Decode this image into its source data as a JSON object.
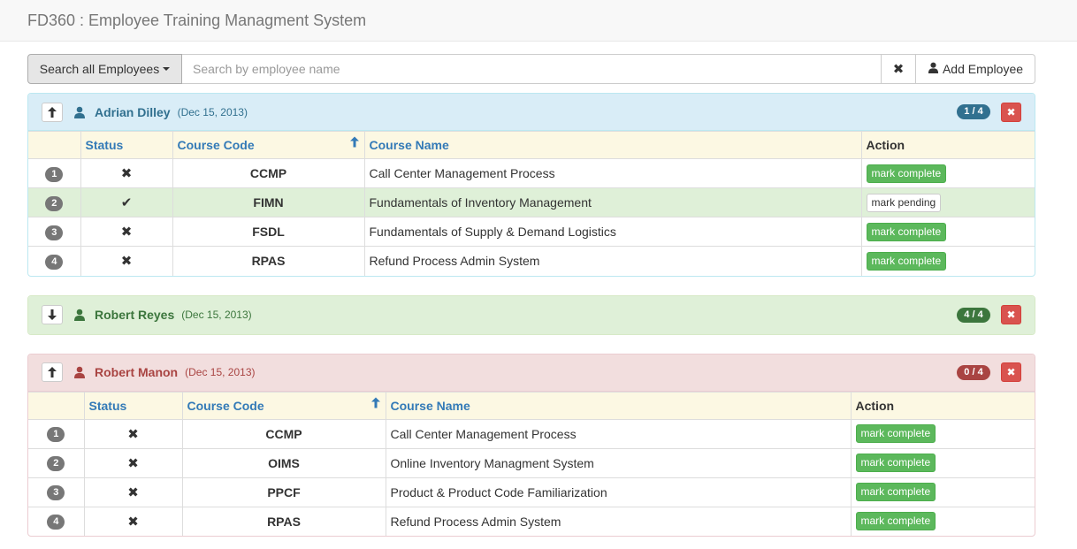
{
  "app": {
    "title": "FD360 : Employee Training Managment System"
  },
  "search": {
    "dropdown_label": "Search all Employees",
    "placeholder": "Search by employee name",
    "value": "",
    "clear_icon": "✖",
    "add_label": "Add Employee"
  },
  "table_headers": {
    "status": "Status",
    "code": "Course Code",
    "name": "Course Name",
    "action": "Action"
  },
  "actions": {
    "complete": "mark complete",
    "pending": "mark pending"
  },
  "colors": {
    "info": "#d9edf7",
    "success": "#dff0d8",
    "danger": "#f2dede",
    "complete_button": "#5cb85c",
    "delete_button": "#d9534f"
  },
  "employees": [
    {
      "name": "Adrian Dilley",
      "date": "(Dec 15, 2013)",
      "progress": "1 / 4",
      "expanded": true,
      "courses": [
        {
          "num": "1",
          "status": "✖",
          "code": "CCMP",
          "name": "Call Center Management Process"
        },
        {
          "num": "2",
          "status": "✔",
          "code": "FIMN",
          "name": "Fundamentals of Inventory Management"
        },
        {
          "num": "3",
          "status": "✖",
          "code": "FSDL",
          "name": "Fundamentals of Supply & Demand Logistics"
        },
        {
          "num": "4",
          "status": "✖",
          "code": "RPAS",
          "name": "Refund Process Admin System"
        }
      ]
    },
    {
      "name": "Robert Reyes",
      "date": "(Dec 15, 2013)",
      "progress": "4 / 4",
      "expanded": false
    },
    {
      "name": "Robert Manon",
      "date": "(Dec 15, 2013)",
      "progress": "0 / 4",
      "expanded": true,
      "courses": [
        {
          "num": "1",
          "status": "✖",
          "code": "CCMP",
          "name": "Call Center Management Process"
        },
        {
          "num": "2",
          "status": "✖",
          "code": "OIMS",
          "name": "Online Inventory Managment System"
        },
        {
          "num": "3",
          "status": "✖",
          "code": "PPCF",
          "name": "Product & Product Code Familiarization"
        },
        {
          "num": "4",
          "status": "✖",
          "code": "RPAS",
          "name": "Refund Process Admin System"
        }
      ]
    }
  ]
}
